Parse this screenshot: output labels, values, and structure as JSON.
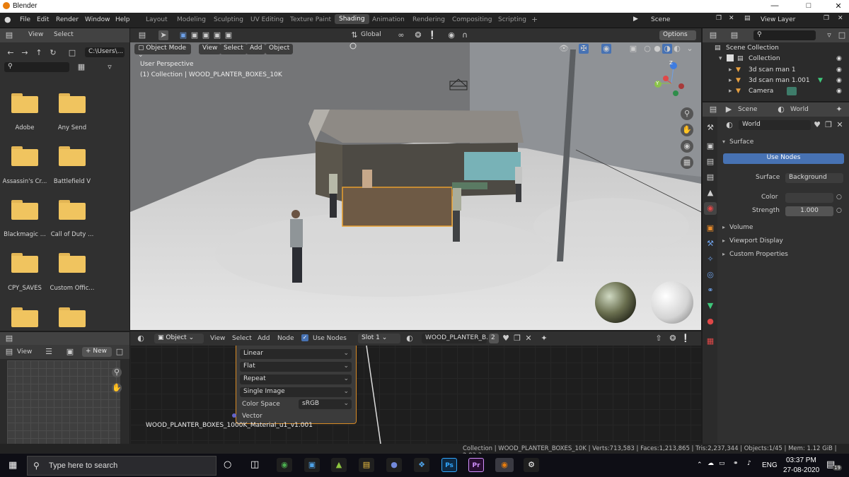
{
  "window": {
    "title": "Blender"
  },
  "menu": [
    "File",
    "Edit",
    "Render",
    "Window",
    "Help"
  ],
  "workspaces": [
    "Layout",
    "Modeling",
    "Sculpting",
    "UV Editing",
    "Texture Paint",
    "Shading",
    "Animation",
    "Rendering",
    "Compositing",
    "Scripting"
  ],
  "active_workspace": "Shading",
  "scene": {
    "name": "Scene",
    "view_layer": "View Layer"
  },
  "filebrowser": {
    "header": [
      "View",
      "Select"
    ],
    "path": "C:\\Users\\...",
    "folders": [
      "Adobe",
      "Any Send",
      "Assassin's Cr...",
      "Battlefield V",
      "Blackmagic ...",
      "Call of Duty ...",
      "CPY_SAVES",
      "Custom Offic...",
      "",
      ""
    ]
  },
  "image_editor": {
    "view": "View",
    "new_label": "New"
  },
  "viewport": {
    "mode": "Object Mode",
    "header_items": [
      "View",
      "Select",
      "Add",
      "Object"
    ],
    "transform": "Global",
    "options": "Options",
    "info_line1": "User Perspective",
    "info_line2": "(1) Collection | WOOD_PLANTER_BOXES_10K",
    "gizmo_z": "Z",
    "gizmo_y": "Y"
  },
  "outliner": {
    "title": "Scene Collection",
    "rows": [
      {
        "label": "Collection",
        "icon": "collection-icon"
      },
      {
        "label": "3d scan man 1",
        "icon": "mesh-icon"
      },
      {
        "label": "3d scan man 1.001",
        "icon": "mesh-icon"
      },
      {
        "label": "Camera",
        "icon": "camera-icon"
      }
    ]
  },
  "properties": {
    "tabs": [
      "Scene",
      "World"
    ],
    "world_name": "World",
    "surface_section": "Surface",
    "use_nodes_button": "Use Nodes",
    "surface_label": "Surface",
    "surface_value": "Background",
    "color_label": "Color",
    "strength_label": "Strength",
    "strength_value": "1.000",
    "sections": [
      "Volume",
      "Viewport Display",
      "Custom Properties"
    ]
  },
  "node_editor": {
    "type": "Object",
    "header_items": [
      "View",
      "Select",
      "Add",
      "Node"
    ],
    "use_nodes": "Use Nodes",
    "slot": "Slot 1",
    "material": "WOOD_PLANTER_B...",
    "user_count": "2",
    "node_rows": [
      "Linear",
      "Flat",
      "Repeat",
      "Single Image"
    ],
    "color_space_label": "Color Space",
    "color_space_value": "sRGB",
    "vector_label": "Vector",
    "node_title": "WOOD_PLANTER_BOXES_1000K_Material_u1_v1.001"
  },
  "statusbar": {
    "text": "Collection | WOOD_PLANTER_BOXES_10K | Verts:713,583 | Faces:1,213,865 | Tris:2,237,344 | Objects:1/45 | Mem: 1.12 GiB | 2.83.3"
  },
  "taskbar": {
    "search_placeholder": "Type here to search",
    "lang": "ENG",
    "time": "03:37 PM",
    "date": "27-08-2020",
    "notif": "19",
    "apps": [
      "chrome",
      "files",
      "explorer",
      "discord",
      "dropbox",
      "Ps",
      "Pr",
      "blender",
      "settings"
    ]
  },
  "colors": {
    "accent": "#4772b3",
    "orange": "#e87d0d"
  }
}
